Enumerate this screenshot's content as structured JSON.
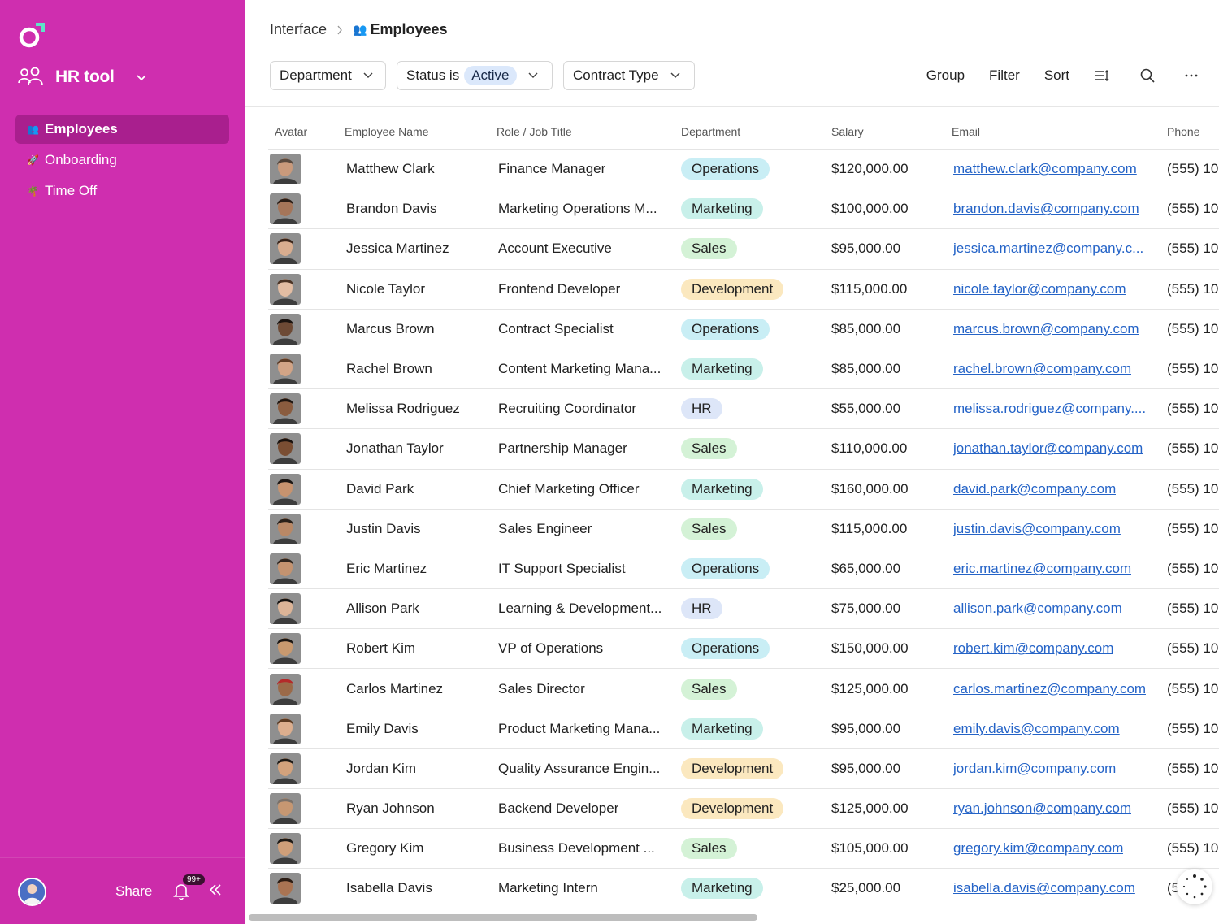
{
  "sidebar": {
    "app_name": "HR tool",
    "nav": [
      {
        "label": "Employees",
        "emoji": "👥",
        "active": true
      },
      {
        "label": "Onboarding",
        "emoji": "🚀",
        "active": false
      },
      {
        "label": "Time Off",
        "emoji": "🌴",
        "active": false
      }
    ],
    "footer": {
      "share_label": "Share",
      "notification_count": "99+"
    }
  },
  "breadcrumb": {
    "parent": "Interface",
    "current": "Employees",
    "current_emoji": "👥"
  },
  "toolbar": {
    "filters": {
      "department": "Department",
      "status_prefix": "Status is",
      "status_value": "Active",
      "contract": "Contract Type"
    },
    "group": "Group",
    "filter": "Filter",
    "sort": "Sort"
  },
  "table": {
    "columns": {
      "avatar": "Avatar",
      "name": "Employee Name",
      "role": "Role / Job Title",
      "department": "Department",
      "salary": "Salary",
      "email": "Email",
      "phone": "Phone"
    },
    "rows": [
      {
        "name": "Matthew Clark",
        "role": "Finance Manager",
        "department": "Operations",
        "salary": "$120,000.00",
        "email": "matthew.clark@company.com",
        "phone": "(555) 10"
      },
      {
        "name": "Brandon Davis",
        "role": "Marketing Operations M...",
        "department": "Marketing",
        "salary": "$100,000.00",
        "email": "brandon.davis@company.com",
        "phone": "(555) 10"
      },
      {
        "name": "Jessica Martinez",
        "role": "Account Executive",
        "department": "Sales",
        "salary": "$95,000.00",
        "email": "jessica.martinez@company.c...",
        "phone": "(555) 10"
      },
      {
        "name": "Nicole Taylor",
        "role": "Frontend Developer",
        "department": "Development",
        "salary": "$115,000.00",
        "email": "nicole.taylor@company.com",
        "phone": "(555) 10"
      },
      {
        "name": "Marcus Brown",
        "role": "Contract Specialist",
        "department": "Operations",
        "salary": "$85,000.00",
        "email": "marcus.brown@company.com",
        "phone": "(555) 10"
      },
      {
        "name": "Rachel Brown",
        "role": "Content Marketing Mana...",
        "department": "Marketing",
        "salary": "$85,000.00",
        "email": "rachel.brown@company.com",
        "phone": "(555) 10"
      },
      {
        "name": "Melissa Rodriguez",
        "role": "Recruiting Coordinator",
        "department": "HR",
        "salary": "$55,000.00",
        "email": "melissa.rodriguez@company....",
        "phone": "(555) 10"
      },
      {
        "name": "Jonathan Taylor",
        "role": "Partnership Manager",
        "department": "Sales",
        "salary": "$110,000.00",
        "email": "jonathan.taylor@company.com",
        "phone": "(555) 10"
      },
      {
        "name": "David Park",
        "role": "Chief Marketing Officer",
        "department": "Marketing",
        "salary": "$160,000.00",
        "email": "david.park@company.com",
        "phone": "(555) 10"
      },
      {
        "name": "Justin Davis",
        "role": "Sales Engineer",
        "department": "Sales",
        "salary": "$115,000.00",
        "email": "justin.davis@company.com",
        "phone": "(555) 10"
      },
      {
        "name": "Eric Martinez",
        "role": "IT Support Specialist",
        "department": "Operations",
        "salary": "$65,000.00",
        "email": "eric.martinez@company.com",
        "phone": "(555) 10"
      },
      {
        "name": "Allison Park",
        "role": "Learning & Development...",
        "department": "HR",
        "salary": "$75,000.00",
        "email": "allison.park@company.com",
        "phone": "(555) 10"
      },
      {
        "name": "Robert Kim",
        "role": "VP of Operations",
        "department": "Operations",
        "salary": "$150,000.00",
        "email": "robert.kim@company.com",
        "phone": "(555) 10"
      },
      {
        "name": "Carlos Martinez",
        "role": "Sales Director",
        "department": "Sales",
        "salary": "$125,000.00",
        "email": "carlos.martinez@company.com",
        "phone": "(555) 10"
      },
      {
        "name": "Emily Davis",
        "role": "Product Marketing Mana...",
        "department": "Marketing",
        "salary": "$95,000.00",
        "email": "emily.davis@company.com",
        "phone": "(555) 10"
      },
      {
        "name": "Jordan Kim",
        "role": "Quality Assurance Engin...",
        "department": "Development",
        "salary": "$95,000.00",
        "email": "jordan.kim@company.com",
        "phone": "(555) 10"
      },
      {
        "name": "Ryan Johnson",
        "role": "Backend Developer",
        "department": "Development",
        "salary": "$125,000.00",
        "email": "ryan.johnson@company.com",
        "phone": "(555) 10"
      },
      {
        "name": "Gregory Kim",
        "role": "Business Development ...",
        "department": "Sales",
        "salary": "$105,000.00",
        "email": "gregory.kim@company.com",
        "phone": "(555) 10"
      },
      {
        "name": "Isabella Davis",
        "role": "Marketing Intern",
        "department": "Marketing",
        "salary": "$25,000.00",
        "email": "isabella.davis@company.com",
        "phone": "(5"
      }
    ]
  },
  "colors": {
    "sidebar_bg": "#cf2eaf",
    "sidebar_active": "#a91f8e",
    "link": "#2463c7",
    "dept_operations": "#c9eef5",
    "dept_marketing": "#c8f0ea",
    "dept_sales": "#d4f2d6",
    "dept_development": "#fbe8bf",
    "dept_hr": "#dde6f8",
    "status_pill": "#dbe8fb"
  }
}
